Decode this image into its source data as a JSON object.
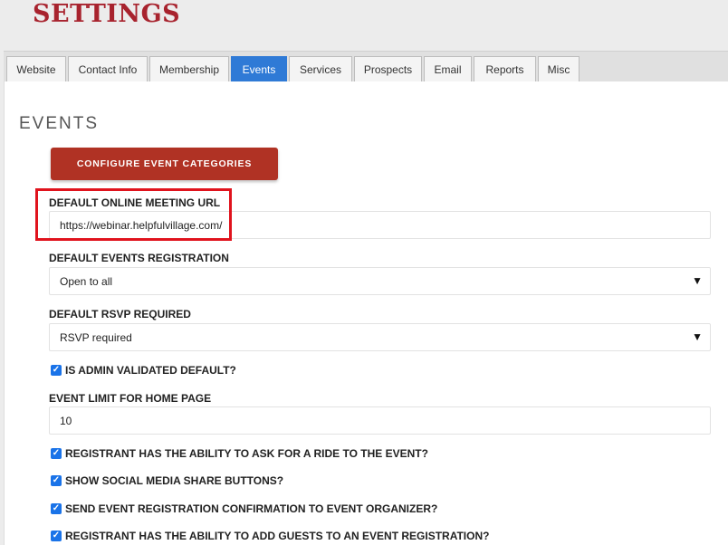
{
  "header": {
    "title": "SETTINGS"
  },
  "tabs": [
    {
      "label": "Website"
    },
    {
      "label": "Contact Info"
    },
    {
      "label": "Membership"
    },
    {
      "label": "Events",
      "active": true
    },
    {
      "label": "Services"
    },
    {
      "label": "Prospects"
    },
    {
      "label": "Email"
    },
    {
      "label": "Reports"
    },
    {
      "label": "Misc"
    }
  ],
  "main": {
    "section_title": "EVENTS",
    "configure_button": "CONFIGURE EVENT CATEGORIES",
    "meeting_url": {
      "label": "DEFAULT ONLINE MEETING URL",
      "value": "https://webinar.helpfulvillage.com/"
    },
    "registration": {
      "label": "DEFAULT EVENTS REGISTRATION",
      "value": "Open to all"
    },
    "rsvp": {
      "label": "DEFAULT RSVP REQUIRED",
      "value": "RSVP required"
    },
    "admin_validated": {
      "label": "IS ADMIN VALIDATED DEFAULT?",
      "checked": true
    },
    "event_limit": {
      "label": "EVENT LIMIT FOR HOME PAGE",
      "value": "10"
    },
    "ride": {
      "label": "REGISTRANT HAS THE ABILITY TO ASK FOR A RIDE TO THE EVENT?",
      "checked": true
    },
    "social": {
      "label": "SHOW SOCIAL MEDIA SHARE BUTTONS?",
      "checked": true
    },
    "confirmation": {
      "label": "SEND EVENT REGISTRATION CONFIRMATION TO EVENT ORGANIZER?",
      "checked": true
    },
    "guests": {
      "label": "REGISTRANT HAS THE ABILITY TO ADD GUESTS TO AN EVENT REGISTRATION?",
      "checked": true
    }
  },
  "colors": {
    "brand": "#a8232e",
    "button": "#b03224",
    "active_tab": "#2f7ad6",
    "highlight": "#e0131d",
    "checkbox": "#1a73e8"
  },
  "icons": {
    "dropdown": "triangle-down-icon",
    "checkbox": "checkmark-icon"
  }
}
